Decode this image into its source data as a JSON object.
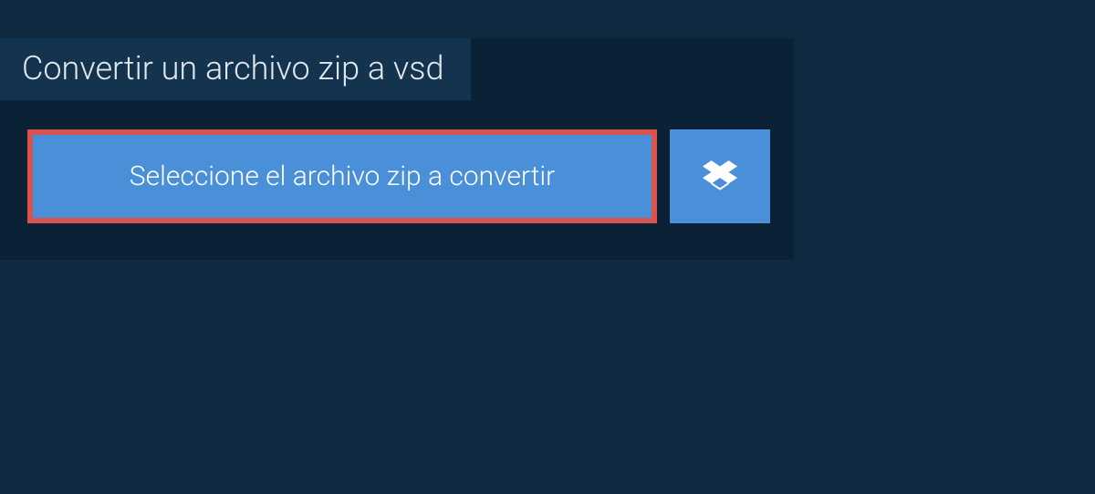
{
  "header": {
    "title": "Convertir un archivo zip a vsd"
  },
  "buttons": {
    "select_file": "Seleccione el archivo zip a convertir"
  },
  "colors": {
    "background": "#0f2940",
    "panel": "#0a2136",
    "tab": "#13334f",
    "button": "#4a90d9",
    "highlight_border": "#d9534f"
  }
}
